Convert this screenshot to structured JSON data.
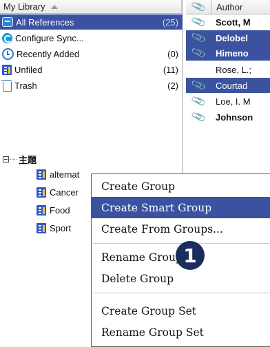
{
  "library": {
    "header": "My Library",
    "items": [
      {
        "label": "All References",
        "count": "(25)",
        "icon": "all-references-icon"
      },
      {
        "label": "Configure Sync...",
        "count": "",
        "icon": "sync-icon"
      },
      {
        "label": "Recently Added",
        "count": "(0)",
        "icon": "clock-icon"
      },
      {
        "label": "Unfiled",
        "count": "(11)",
        "icon": "document-icon"
      },
      {
        "label": "Trash",
        "count": "(2)",
        "icon": "trash-icon"
      }
    ],
    "group_title": "主題",
    "subgroups": [
      "alternat",
      "Cancer",
      "Food",
      "Sport"
    ]
  },
  "references": {
    "column_author": "Author",
    "rows": [
      {
        "author": "Scott, M"
      },
      {
        "author": "Delobel"
      },
      {
        "author": "Himeno"
      },
      {
        "author": "Rose, L.;"
      },
      {
        "author": "Courtad"
      },
      {
        "author": "Loe, I. M"
      },
      {
        "author": "Johnson"
      }
    ]
  },
  "context_menu": {
    "items": [
      "Create Group",
      "Create Smart Group",
      "Create From Groups...",
      "Rename Group",
      "Delete Group",
      "Create Group Set",
      "Rename Group Set"
    ]
  },
  "annotation_marker": "1",
  "colors": {
    "selection": "#3a52a0",
    "marker": "#1b2d5c"
  }
}
